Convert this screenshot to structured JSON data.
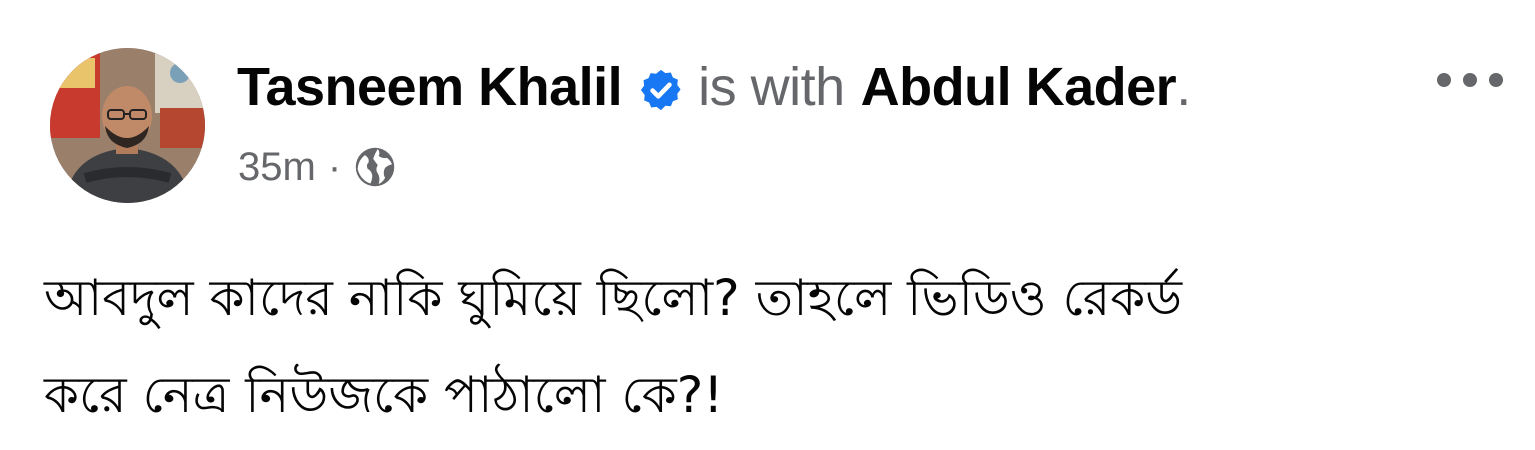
{
  "post": {
    "author": {
      "name": "Tasneem Khalil",
      "verified": true,
      "avatar_icon": "profile-photo"
    },
    "with_text": "is with",
    "tagged": {
      "name": "Abdul Kader",
      "trailing": "."
    },
    "timestamp": "35m",
    "separator": "·",
    "privacy_icon": "globe-icon",
    "more_icon": "more-options-icon",
    "body_text": "আবদুল কাদের নাকি ঘুমিয়ে ছিলো? তাহলে ভিডিও রেকর্ড\nকরে নেত্র নিউজকে পাঠালো কে?!",
    "colors": {
      "primary_text": "#050505",
      "secondary_text": "#65676b",
      "verified_badge": "#1877f2"
    }
  }
}
